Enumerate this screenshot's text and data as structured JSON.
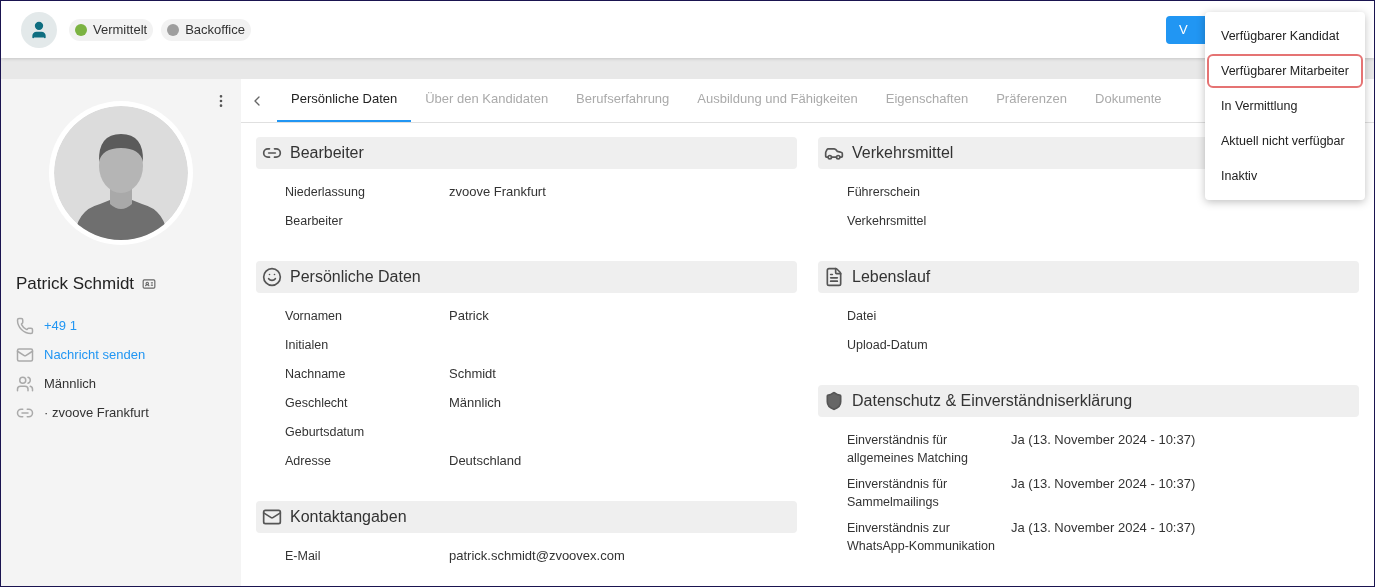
{
  "header": {
    "tags": [
      {
        "label": "Vermittelt",
        "color": "#7cb342"
      },
      {
        "label": "Backoffice",
        "color": "#9e9e9e"
      }
    ],
    "status_button": {
      "label": "V"
    },
    "menu": [
      {
        "label": "Verfügbarer Kandidat",
        "selected": false
      },
      {
        "label": "Verfügbarer Mitarbeiter",
        "selected": true
      },
      {
        "label": "In Vermittlung",
        "selected": false
      },
      {
        "label": "Aktuell nicht verfügbar",
        "selected": false
      },
      {
        "label": "Inaktiv",
        "selected": false
      }
    ]
  },
  "sidebar": {
    "name": "Patrick Schmidt",
    "contacts": [
      {
        "kind": "phone",
        "text": "+49 1",
        "link": true
      },
      {
        "kind": "mail",
        "text": "Nachricht senden",
        "link": true
      },
      {
        "kind": "gender",
        "text": "Männlich",
        "link": false
      },
      {
        "kind": "link",
        "text": "· zvoove Frankfurt",
        "link": false
      }
    ]
  },
  "tabs": [
    {
      "label": "Persönliche Daten",
      "selected": true
    },
    {
      "label": "Über den Kandidaten",
      "selected": false
    },
    {
      "label": "Berufserfahrung",
      "selected": false
    },
    {
      "label": "Ausbildung und Fähigkeiten",
      "selected": false
    },
    {
      "label": "Eigenschaften",
      "selected": false
    },
    {
      "label": "Präferenzen",
      "selected": false
    },
    {
      "label": "Dokumente",
      "selected": false
    }
  ],
  "columns": [
    [
      {
        "kind": "link",
        "title": "Bearbeiter",
        "rows": [
          {
            "label": "Niederlassung",
            "value": "zvoove Frankfurt"
          },
          {
            "label": "Bearbeiter"
          }
        ]
      },
      {
        "kind": "face",
        "title": "Persönliche Daten",
        "rows": [
          {
            "label": "Vornamen",
            "value": "Patrick"
          },
          {
            "label": "Initialen"
          },
          {
            "label": "Nachname",
            "value": "Schmidt"
          },
          {
            "label": "Geschlecht",
            "value": "Männlich"
          },
          {
            "label": "Geburtsdatum"
          },
          {
            "label": "Adresse",
            "value": "Deutschland"
          }
        ]
      },
      {
        "kind": "mail",
        "title": "Kontaktangaben",
        "rows": [
          {
            "label": "E-Mail",
            "value": "patrick.schmidt@zvoovex.com"
          }
        ]
      }
    ],
    [
      {
        "kind": "car",
        "title": "Verkehrsmittel",
        "rows": [
          {
            "label": "Führerschein"
          },
          {
            "label": "Verkehrsmittel"
          }
        ]
      },
      {
        "kind": "document",
        "title": "Lebenslauf",
        "rows": [
          {
            "label": "Datei"
          },
          {
            "label": "Upload-Datum"
          }
        ]
      },
      {
        "kind": "shield",
        "title": "Datenschutz & Einverständniserklärung",
        "rows": [
          {
            "label": "Einverständnis für allgemeines Matching",
            "value": "Ja (13. November 2024 - 10:37)"
          },
          {
            "label": "Einverständnis für Sammelmailings",
            "value": "Ja (13. November 2024 - 10:37)"
          },
          {
            "label": "Einverständnis zur WhatsApp-Kommunikation",
            "value": "Ja (13. November 2024 - 10:37)"
          }
        ]
      }
    ]
  ]
}
